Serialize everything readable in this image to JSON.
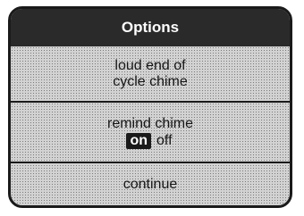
{
  "panel": {
    "title": "Options",
    "buttons": [
      {
        "lines": [
          "loud end of",
          "cycle chime"
        ]
      },
      {
        "lines": [
          "remind chime"
        ],
        "toggle": {
          "on": "on",
          "off": "off",
          "selected": "on"
        }
      },
      {
        "lines": [
          "continue"
        ]
      }
    ]
  },
  "colors": {
    "title_bg": "#2a2a2a",
    "panel_bg": "#d2d2d2",
    "border": "#1a1a1a",
    "text": "#161616",
    "selected_bg": "#1a1a1a",
    "selected_text": "#ffffff"
  }
}
